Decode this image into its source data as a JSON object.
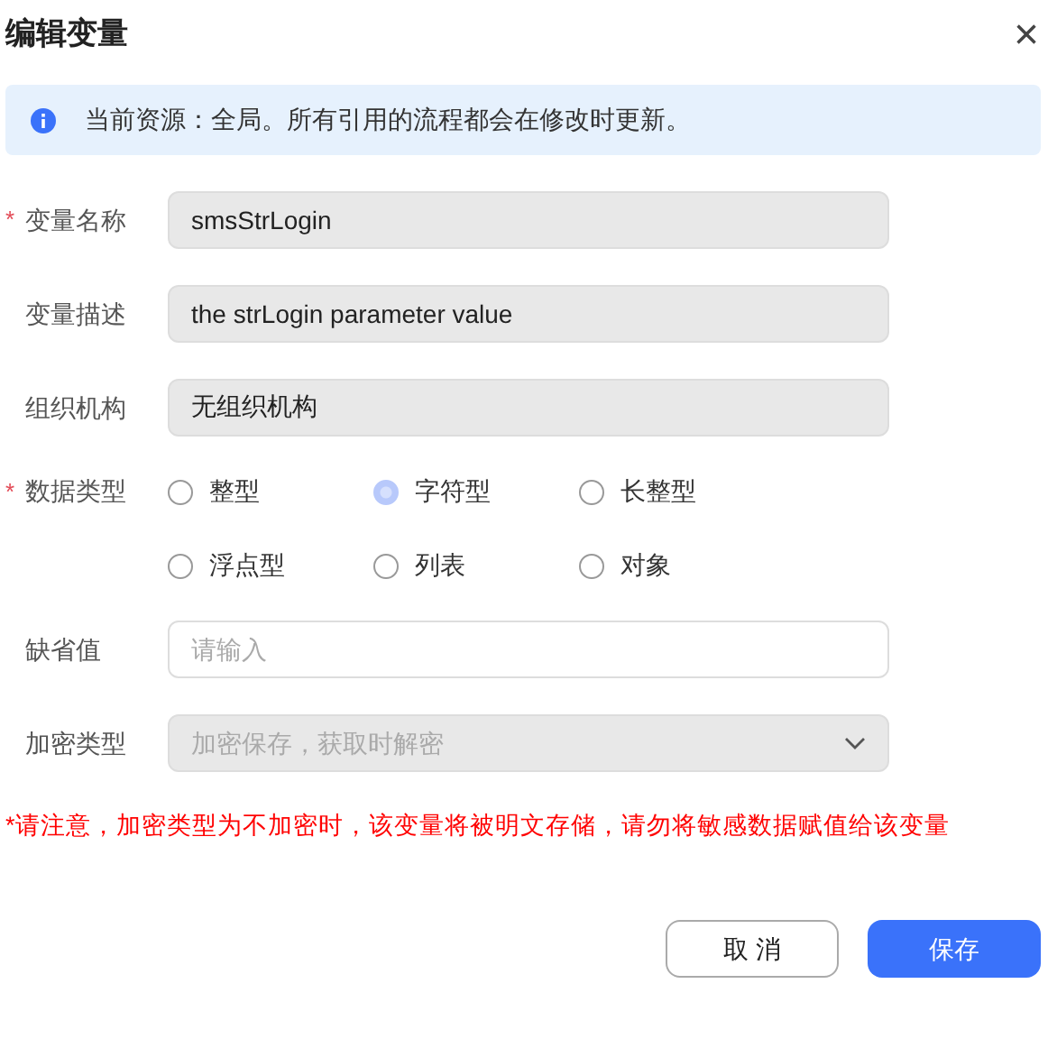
{
  "dialog": {
    "title": "编辑变量",
    "close": "×"
  },
  "alert": {
    "text": "当前资源：全局。所有引用的流程都会在修改时更新。"
  },
  "fields": [
    {
      "kind": "text",
      "label": "变量名称",
      "required_mark": "*",
      "value": "smsStrLogin",
      "disabled": true
    },
    {
      "kind": "text",
      "label": "变量描述",
      "value": "the strLogin parameter value",
      "disabled": true
    },
    {
      "kind": "text",
      "label": "组织机构",
      "value": "无组织机构",
      "disabled": true
    },
    {
      "kind": "radio",
      "label": "数据类型",
      "required_mark": "*",
      "options": [
        {
          "label": "整型",
          "selected": false
        },
        {
          "label": "字符型",
          "selected": true
        },
        {
          "label": "长整型",
          "selected": false
        },
        {
          "label": "浮点型",
          "selected": false
        },
        {
          "label": "列表",
          "selected": false
        },
        {
          "label": "对象",
          "selected": false
        }
      ]
    },
    {
      "kind": "text",
      "label": "缺省值",
      "placeholder": "请输入",
      "disabled": false
    },
    {
      "kind": "select",
      "label": "加密类型",
      "placeholder": "加密保存，获取时解密",
      "disabled": true
    }
  ],
  "warning": "*请注意，加密类型为不加密时，该变量将被明文存储，请勿将敏感数据赋值给该变量",
  "buttons": [
    {
      "label": "取 消",
      "kind": "secondary"
    },
    {
      "label": "保存",
      "kind": "primary"
    }
  ]
}
